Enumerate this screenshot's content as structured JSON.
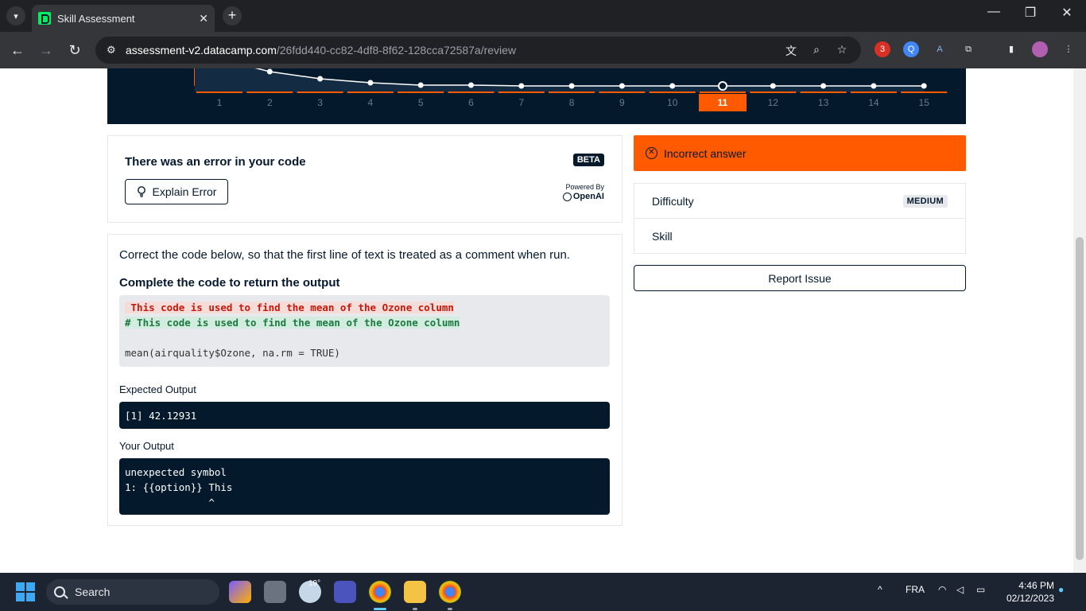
{
  "browser": {
    "tab_title": "Skill Assessment",
    "url_host": "assessment-v2.datacamp.com",
    "url_path": "/26fdd440-cc82-4df8-8f62-128cca72587a/review",
    "extension_badge": "3"
  },
  "progress_chart": {
    "question_numbers": [
      "1",
      "2",
      "3",
      "4",
      "5",
      "6",
      "7",
      "8",
      "9",
      "10",
      "11",
      "12",
      "13",
      "14",
      "15"
    ],
    "current_question": "11"
  },
  "error_panel": {
    "title": "There was an error in your code",
    "badge": "BETA",
    "explain_button": "Explain Error",
    "powered_by": "Powered By",
    "provider": "OpenAI"
  },
  "question": {
    "prompt": "Correct the code below, so that the first line of text is treated as a comment when run.",
    "instruction": "Complete the code to return the output",
    "code_removed": " This code is used to find the mean of the Ozone column",
    "code_added": "# This code is used to find the mean of the Ozone column",
    "code_line": "mean(airquality$Ozone, na.rm = TRUE)",
    "expected_label": "Expected Output",
    "expected_output": "[1] 42.12931",
    "your_label": "Your Output",
    "your_output": "unexpected symbol\n1: {{option}} This\n              ^"
  },
  "result": {
    "status": "Incorrect answer",
    "difficulty_label": "Difficulty",
    "difficulty_value": "MEDIUM",
    "skill_label": "Skill",
    "report_button": "Report Issue"
  },
  "taskbar": {
    "search_placeholder": "Search",
    "weather": "19°",
    "language": "FRA",
    "time": "4:46 PM",
    "date": "02/12/2023"
  },
  "colors": {
    "navy": "#05192d",
    "accent_orange": "#ff5a00",
    "datacamp_green": "#03ef62"
  }
}
